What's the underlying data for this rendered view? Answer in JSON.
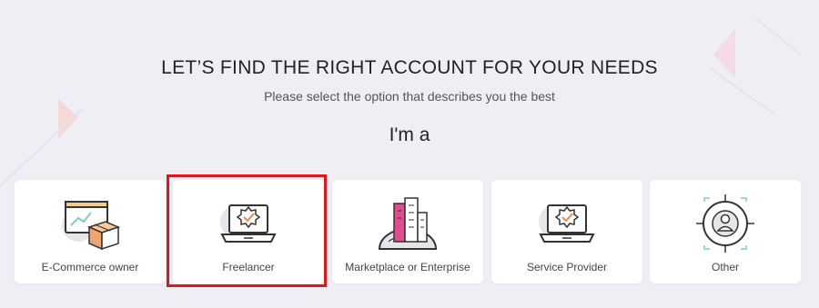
{
  "header": {
    "title": "LET’S FIND THE RIGHT ACCOUNT FOR YOUR NEEDS",
    "subtitle": "Please select the option that describes you the best",
    "prompt": "I'm a"
  },
  "options": [
    {
      "label": "E-Commerce owner",
      "icon": "ecommerce-box-icon"
    },
    {
      "label": "Freelancer",
      "icon": "laptop-badge-icon",
      "highlighted": true
    },
    {
      "label": "Marketplace or Enterprise",
      "icon": "city-globe-icon"
    },
    {
      "label": "Service Provider",
      "icon": "laptop-badge-icon"
    },
    {
      "label": "Other",
      "icon": "user-target-icon"
    }
  ],
  "colors": {
    "background": "#efeef5",
    "card": "#ffffff",
    "accent_pink": "#e24b8e",
    "accent_orange": "#f08a4b",
    "accent_teal": "#7fcdbf",
    "highlight_border": "#e3141b"
  }
}
